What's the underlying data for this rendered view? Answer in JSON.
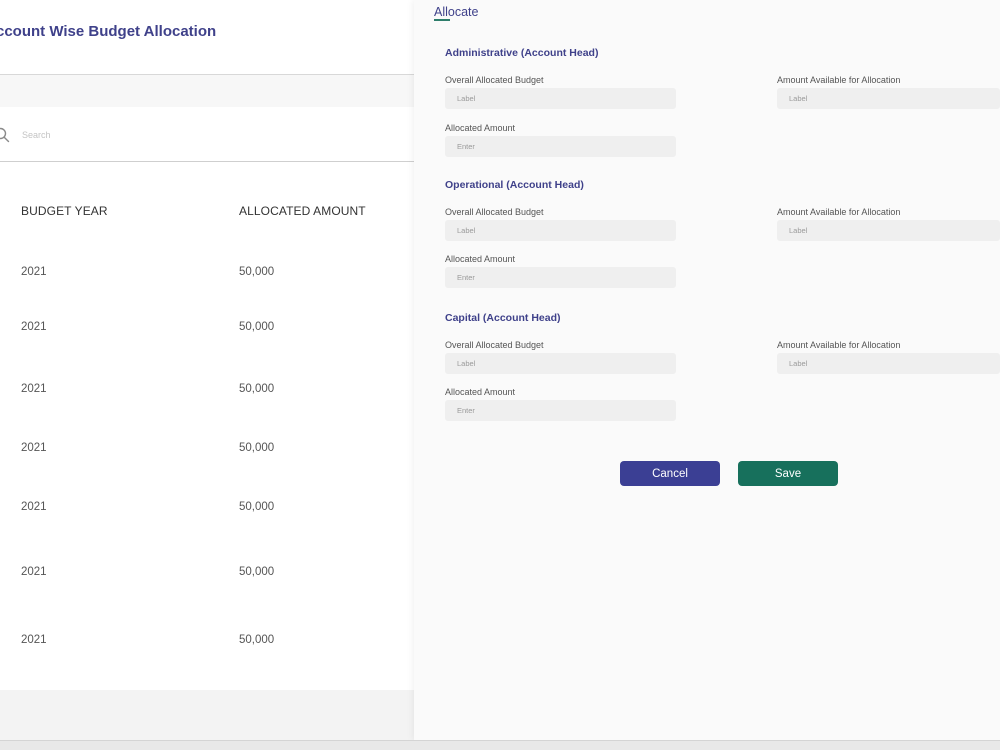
{
  "page": {
    "title": "ccount Wise Budget Allocation"
  },
  "search": {
    "placeholder": "Search"
  },
  "table": {
    "columns": [
      "BUDGET YEAR",
      "ALLOCATED AMOUNT"
    ],
    "rows": [
      {
        "year": "2021",
        "amount": "50,000"
      },
      {
        "year": "2021",
        "amount": "50,000"
      },
      {
        "year": "2021",
        "amount": "50,000"
      },
      {
        "year": "2021",
        "amount": "50,000"
      },
      {
        "year": "2021",
        "amount": "50,000"
      },
      {
        "year": "2021",
        "amount": "50,000"
      },
      {
        "year": "2021",
        "amount": "50,000"
      }
    ]
  },
  "drawer": {
    "title": "Allocate",
    "sections": [
      {
        "heading": "Administrative (Account Head)",
        "overall_label": "Overall Allocated Budget",
        "overall_placeholder": "Label",
        "available_label": "Amount Available for Allocation",
        "available_placeholder": "Label",
        "allocated_label": "Allocated Amount",
        "allocated_placeholder": "Enter"
      },
      {
        "heading": "Operational (Account Head)",
        "overall_label": "Overall Allocated Budget",
        "overall_placeholder": "Label",
        "available_label": "Amount Available for Allocation",
        "available_placeholder": "Label",
        "allocated_label": "Allocated Amount",
        "allocated_placeholder": "Enter"
      },
      {
        "heading": "Capital (Account Head)",
        "overall_label": "Overall Allocated Budget",
        "overall_placeholder": "Label",
        "available_label": "Amount Available for Allocation",
        "available_placeholder": "Label",
        "allocated_label": "Allocated Amount",
        "allocated_placeholder": "Enter"
      }
    ],
    "cancel_label": "Cancel",
    "save_label": "Save"
  },
  "colors": {
    "accent": "#3f418a",
    "primary_button": "#3b3f94",
    "save_button": "#17705c"
  },
  "icons": {
    "search": "search-icon"
  }
}
